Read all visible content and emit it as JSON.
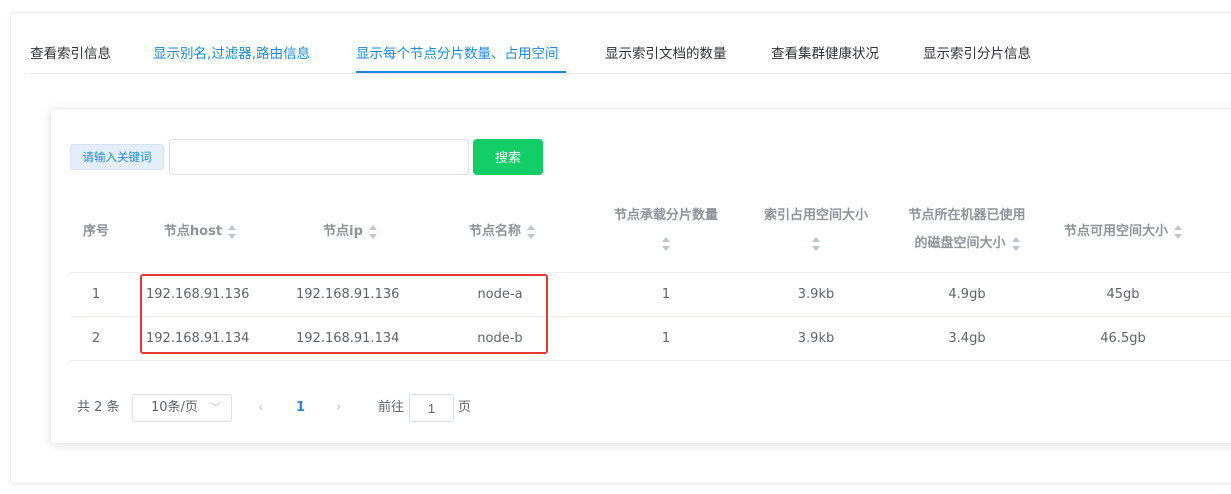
{
  "tabs": [
    {
      "label": "查看索引信息"
    },
    {
      "label": "显示别名,过滤器,路由信息"
    },
    {
      "label": "显示每个节点分片数量、占用空间"
    },
    {
      "label": "显示索引文档的数量"
    },
    {
      "label": "查看集群健康状况"
    },
    {
      "label": "显示索引分片信息"
    }
  ],
  "active_tab": 2,
  "search": {
    "label": "请输入关键词",
    "value": "",
    "button": "搜索"
  },
  "table": {
    "columns": [
      {
        "line1": "序号",
        "line2": ""
      },
      {
        "line1": "节点host",
        "line2": ""
      },
      {
        "line1": "节点ip",
        "line2": ""
      },
      {
        "line1": "节点名称",
        "line2": ""
      },
      {
        "line1": "节点承载分片数量",
        "line2": ""
      },
      {
        "line1": "索引占用空间大小",
        "line2": ""
      },
      {
        "line1": "节点所在机器已使用",
        "line2": "的磁盘空间大小"
      },
      {
        "line1": "节点可用空间大小",
        "line2": ""
      }
    ],
    "rows": [
      [
        "1",
        "192.168.91.136",
        "192.168.91.136",
        "node-a",
        "1",
        "3.9kb",
        "4.9gb",
        "45gb"
      ],
      [
        "2",
        "192.168.91.134",
        "192.168.91.134",
        "node-b",
        "1",
        "3.9kb",
        "3.4gb",
        "46.5gb"
      ]
    ]
  },
  "pagination": {
    "total": "共 2 条",
    "page_size": "10条/页",
    "prev": "‹",
    "page": "1",
    "next": "›",
    "goto_label": "前往",
    "goto_value": "1",
    "goto_unit": "页"
  },
  "colors": {
    "accent": "#1e8ad8",
    "search_button": "#13ce66",
    "highlight_box": "#e53935"
  }
}
